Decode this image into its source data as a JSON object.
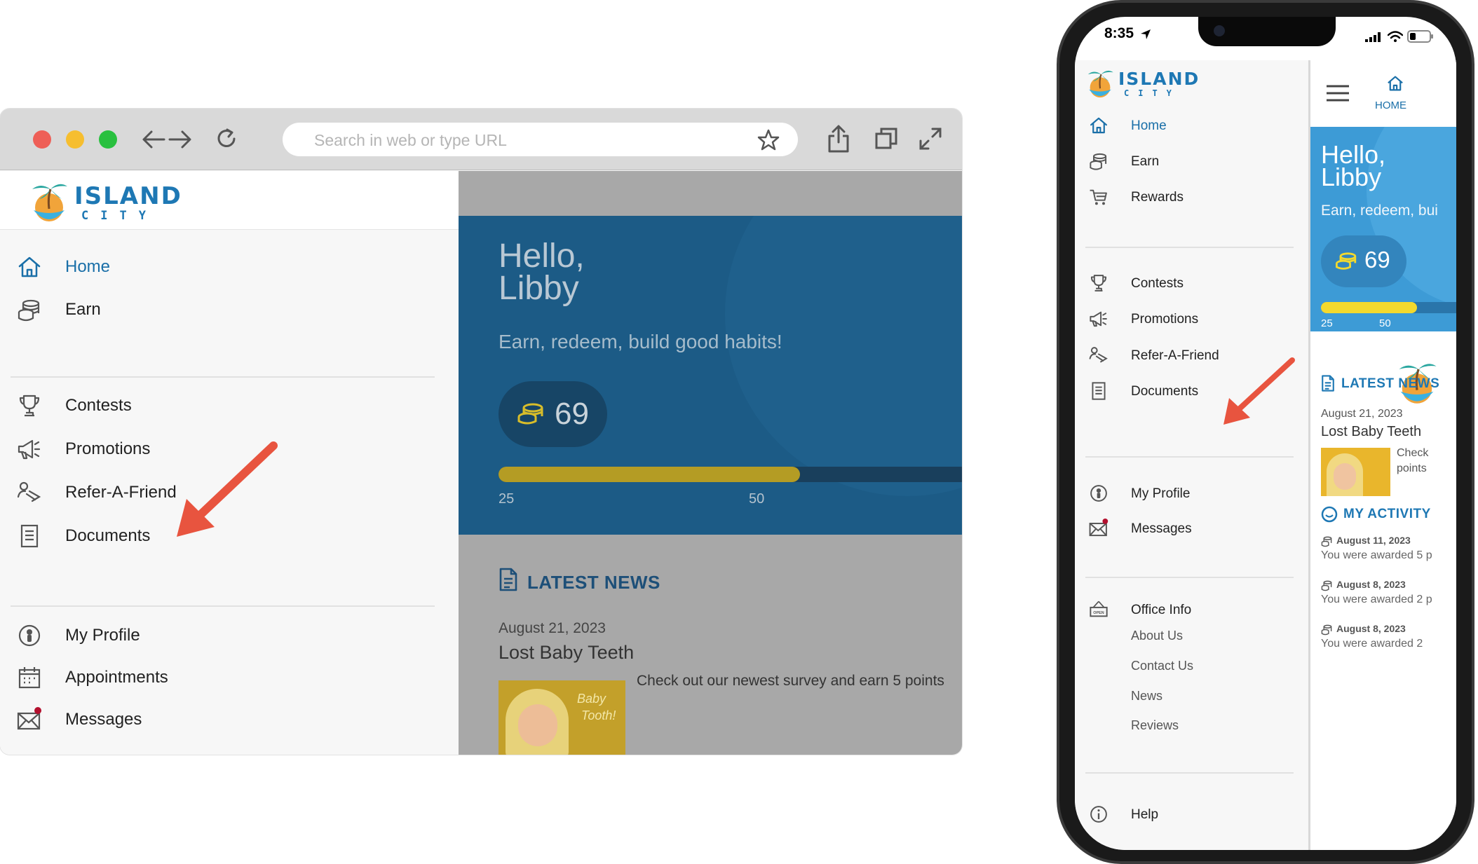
{
  "desktop": {
    "url_placeholder": "Search in web or type URL",
    "logo": {
      "title": "ISLAND",
      "subtitle": "CITY"
    },
    "menu_group_1": [
      {
        "label": "Home",
        "icon": "home-icon",
        "active": true
      },
      {
        "label": "Earn",
        "icon": "coins-icon",
        "active": false
      }
    ],
    "menu_group_2": [
      {
        "label": "Contests",
        "icon": "trophy-icon"
      },
      {
        "label": "Promotions",
        "icon": "megaphone-icon"
      },
      {
        "label": "Refer-A-Friend",
        "icon": "refer-icon"
      },
      {
        "label": "Documents",
        "icon": "document-icon"
      }
    ],
    "menu_group_3": [
      {
        "label": "My Profile",
        "icon": "profile-icon"
      },
      {
        "label": "Appointments",
        "icon": "calendar-icon"
      },
      {
        "label": "Messages",
        "icon": "mail-icon"
      }
    ],
    "hero": {
      "greeting_line1": "Hello,",
      "greeting_line2": "Libby",
      "tagline": "Earn, redeem, build good habits!",
      "points": "69",
      "progress_fraction": 0.65,
      "tick_1": "25",
      "tick_2": "50"
    },
    "news": {
      "heading": "LATEST NEWS",
      "date": "August 21, 2023",
      "title": "Lost Baby Teeth",
      "body": "Check out our newest survey and earn 5 points",
      "thumb_text_1": "Baby",
      "thumb_text_2": "Tooth!"
    }
  },
  "phone": {
    "status_time": "8:35",
    "logo": {
      "title": "ISLAND",
      "subtitle": "CITY"
    },
    "menu_group_1": [
      {
        "label": "Home",
        "icon": "home-icon",
        "active": true
      },
      {
        "label": "Earn",
        "icon": "coins-icon",
        "active": false
      },
      {
        "label": "Rewards",
        "icon": "cart-icon",
        "active": false
      }
    ],
    "menu_group_2": [
      {
        "label": "Contests",
        "icon": "trophy-icon"
      },
      {
        "label": "Promotions",
        "icon": "megaphone-icon"
      },
      {
        "label": "Refer-A-Friend",
        "icon": "refer-icon"
      },
      {
        "label": "Documents",
        "icon": "document-icon"
      }
    ],
    "menu_group_3": [
      {
        "label": "My Profile",
        "icon": "profile-icon"
      },
      {
        "label": "Messages",
        "icon": "mail-icon"
      }
    ],
    "office": {
      "label": "Office Info",
      "icon": "open-sign-icon",
      "sub_items": [
        "About Us",
        "Contact Us",
        "News",
        "Reviews"
      ]
    },
    "help": {
      "label": "Help",
      "icon": "info-icon"
    },
    "topbar_home": "HOME",
    "hero": {
      "greeting_line1": "Hello,",
      "greeting_line2": "Libby",
      "tagline": "Earn, redeem, bui",
      "points": "69",
      "progress_fraction": 0.7,
      "tick_1": "25",
      "tick_2": "50"
    },
    "news": {
      "heading": "LATEST NEWS",
      "date": "August 21, 2023",
      "title": "Lost Baby Teeth",
      "body_1": "Check",
      "body_2": "points"
    },
    "activity": {
      "heading": "MY ACTIVITY",
      "items": [
        {
          "date": "August 11, 2023",
          "text": "You were awarded 5 p"
        },
        {
          "date": "August 8, 2023",
          "text": "You were awarded 2 p"
        },
        {
          "date": "August 8, 2023",
          "text": "You were awarded 2"
        }
      ]
    }
  },
  "colors": {
    "accent": "#1a6fa8",
    "hero_blue_desktop": "#1c5b86",
    "hero_blue_phone": "#3d9bd6",
    "coin_gold": "#d8bd2a",
    "arrow_red": "#e8543f",
    "notification_dot": "#b3102e"
  }
}
